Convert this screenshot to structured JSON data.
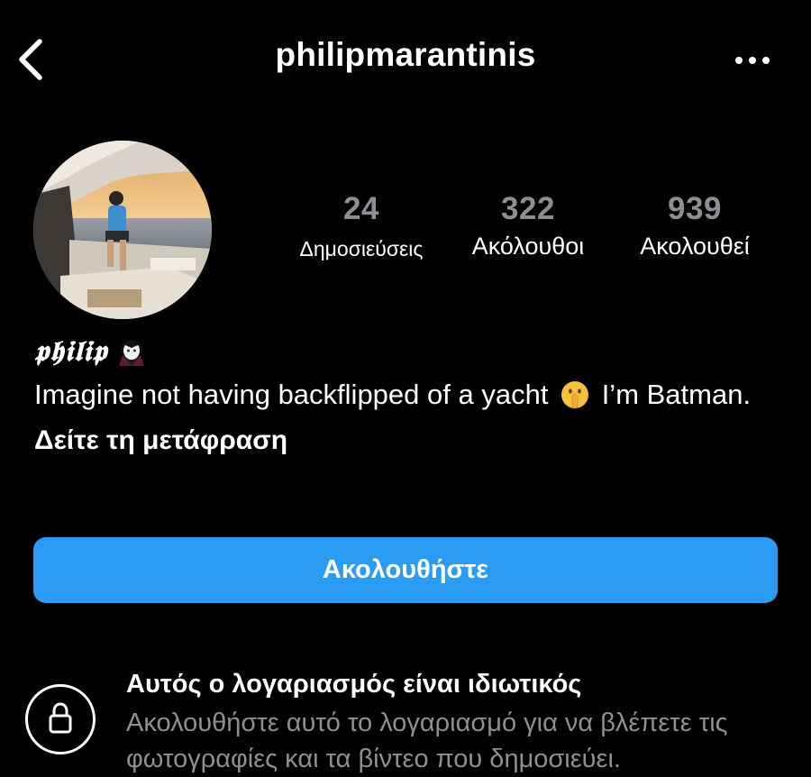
{
  "header": {
    "username": "philipmarantinis",
    "back_icon": "chevron-left-icon",
    "more_icon": "more-horizontal-icon"
  },
  "profile": {
    "avatar_icon": "profile-photo",
    "stats": {
      "posts": {
        "count": "24",
        "label": "Δημοσιεύσεις"
      },
      "followers": {
        "count": "322",
        "label": "Ακόλουθοι"
      },
      "following": {
        "count": "939",
        "label": "Ακολουθεί"
      }
    }
  },
  "bio": {
    "display_name": "𝖕𝖍𝖎𝖑𝖎𝖕",
    "name_emoji": "vampire-emoji",
    "text_before": "Imagine not having backflipped of a yacht",
    "text_emoji": "shushing-face-emoji",
    "text_after": "I’m Batman.",
    "translate_link": "Δείτε τη μετάφραση"
  },
  "actions": {
    "follow_label": "Ακολουθήστε"
  },
  "private_notice": {
    "icon": "lock-icon",
    "title": "Αυτός ο λογαριασμός είναι ιδιωτικός",
    "description": "Ακολουθήστε αυτό το λογαριασμό για να βλέπετε τις φωτογραφίες και τα βίντεο που δημοσιεύει."
  },
  "colors": {
    "background": "#000000",
    "text": "#ffffff",
    "secondary_text": "#8e8e93",
    "follow_button": "#2a9cf4"
  }
}
